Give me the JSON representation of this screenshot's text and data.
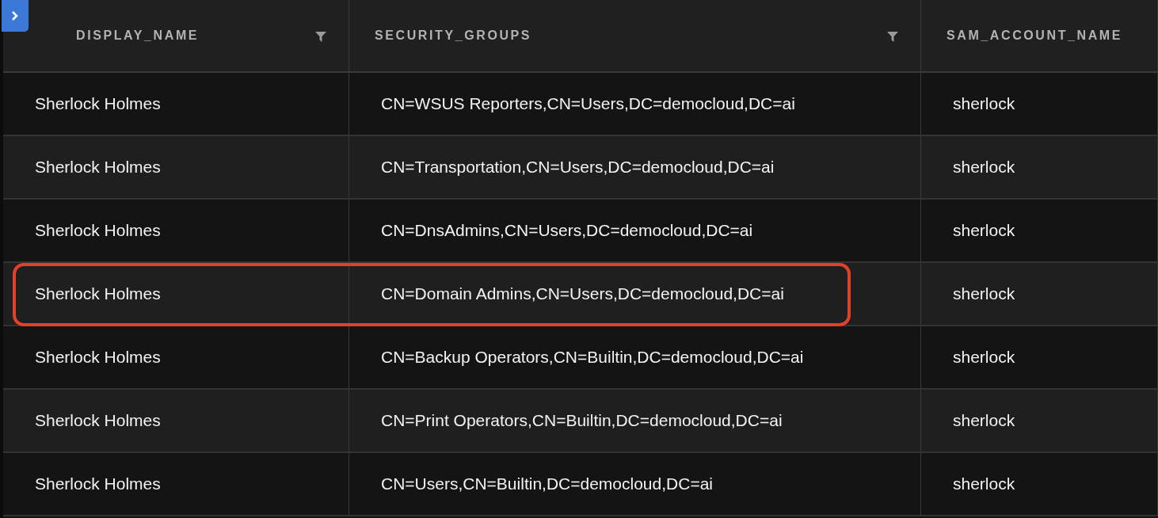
{
  "table": {
    "columns": [
      {
        "label": "DISPLAY_NAME",
        "filter": true
      },
      {
        "label": "SECURITY_GROUPS",
        "filter": true
      },
      {
        "label": "SAM_ACCOUNT_NAME",
        "filter": false
      }
    ],
    "rows": [
      {
        "cells": [
          "Sherlock Holmes",
          "CN=WSUS Reporters,CN=Users,DC=democloud,DC=ai",
          "sherlock"
        ],
        "highlighted": false
      },
      {
        "cells": [
          "Sherlock Holmes",
          "CN=Transportation,CN=Users,DC=democloud,DC=ai",
          "sherlock"
        ],
        "highlighted": false
      },
      {
        "cells": [
          "Sherlock Holmes",
          "CN=DnsAdmins,CN=Users,DC=democloud,DC=ai",
          "sherlock"
        ],
        "highlighted": false
      },
      {
        "cells": [
          "Sherlock Holmes",
          "CN=Domain Admins,CN=Users,DC=democloud,DC=ai",
          "sherlock"
        ],
        "highlighted": true
      },
      {
        "cells": [
          "Sherlock Holmes",
          "CN=Backup Operators,CN=Builtin,DC=democloud,DC=ai",
          "sherlock"
        ],
        "highlighted": false
      },
      {
        "cells": [
          "Sherlock Holmes",
          "CN=Print Operators,CN=Builtin,DC=democloud,DC=ai",
          "sherlock"
        ],
        "highlighted": false
      },
      {
        "cells": [
          "Sherlock Holmes",
          "CN=Users,CN=Builtin,DC=democloud,DC=ai",
          "sherlock"
        ],
        "highlighted": false
      }
    ]
  }
}
